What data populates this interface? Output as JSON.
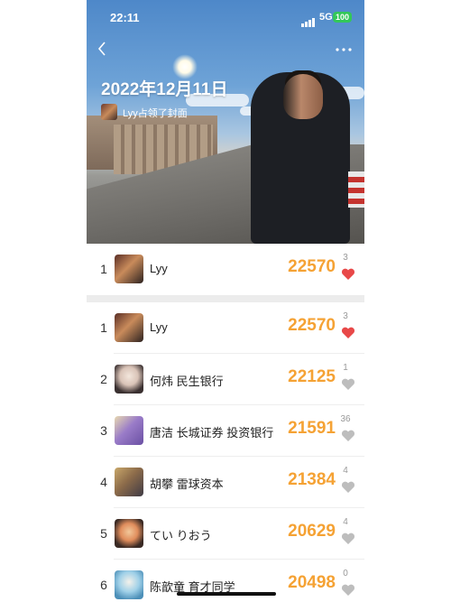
{
  "status_bar": {
    "time": "22:11",
    "network": "5G",
    "battery": "100"
  },
  "header": {
    "title": "2022年12月11日",
    "cover_note": "Lyy占领了封面",
    "back_icon": "chevron-left-icon",
    "more_icon": "more-dots-icon"
  },
  "colors": {
    "steps": "#f5a234",
    "heart_active": "#e84848",
    "heart_inactive": "#bdbdbd"
  },
  "my_rank": {
    "rank": "1",
    "name": "Lyy",
    "steps": "22570",
    "likes": "3",
    "liked": true
  },
  "rankings": [
    {
      "rank": "1",
      "name": "Lyy",
      "steps": "22570",
      "likes": "3",
      "liked": true
    },
    {
      "rank": "2",
      "name": "何炜 民生银行",
      "steps": "22125",
      "likes": "1",
      "liked": false
    },
    {
      "rank": "3",
      "name": "唐洁 长城证券 投资银行",
      "steps": "21591",
      "likes": "36",
      "liked": false
    },
    {
      "rank": "4",
      "name": "胡攀 雷球资本",
      "steps": "21384",
      "likes": "4",
      "liked": false
    },
    {
      "rank": "5",
      "name": "てい りおう",
      "steps": "20629",
      "likes": "4",
      "liked": false
    },
    {
      "rank": "6",
      "name": "陈歆童 育才同学",
      "steps": "20498",
      "likes": "0",
      "liked": false
    }
  ]
}
